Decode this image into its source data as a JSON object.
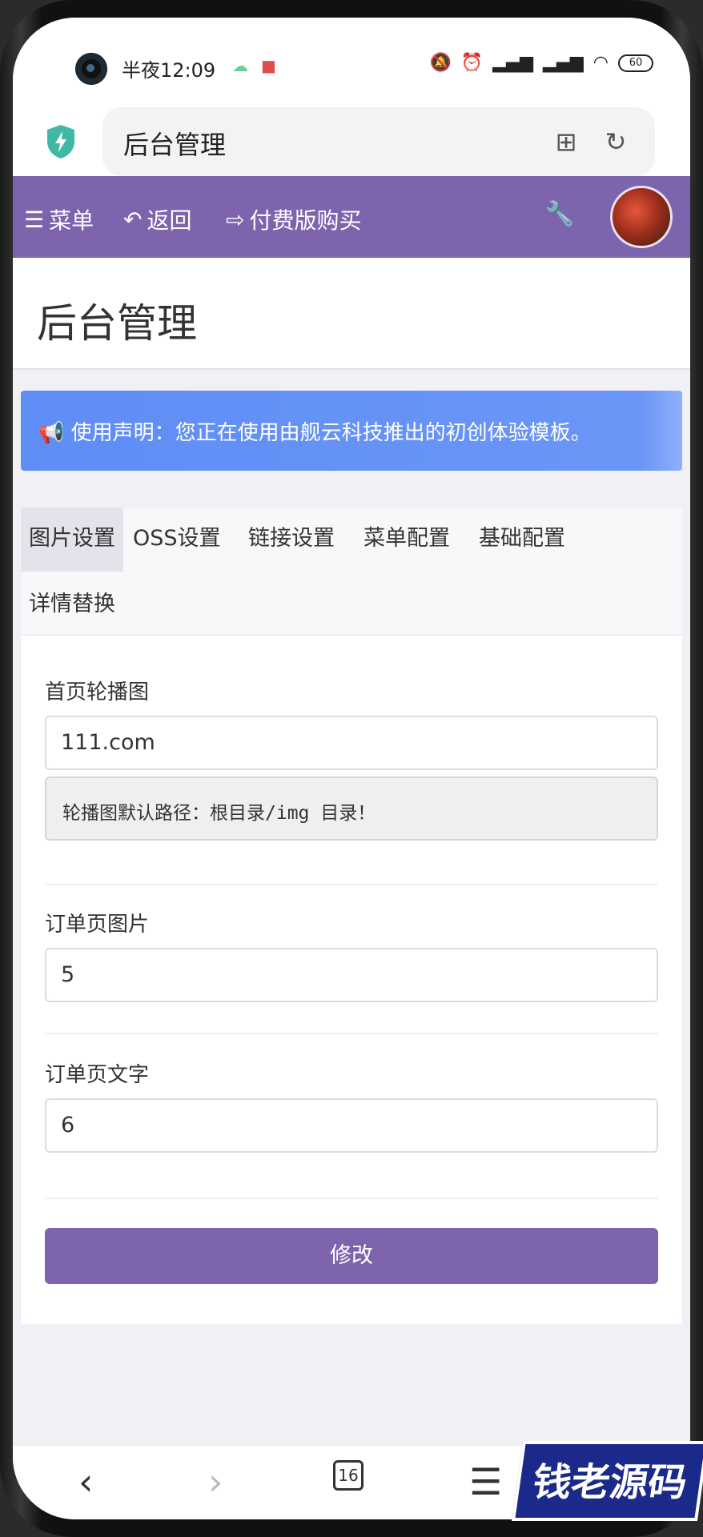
{
  "status_bar": {
    "time": "半夜12:09",
    "battery": "60"
  },
  "browser": {
    "title": "后台管理",
    "tab_count": "16"
  },
  "topnav": {
    "menu": "菜单",
    "back": "返回",
    "buy": "付费版购买"
  },
  "page": {
    "title": "后台管理"
  },
  "alert": {
    "text": "使用声明：您正在使用由舰云科技推出的初创体验模板。"
  },
  "tabs": [
    "图片设置",
    "OSS设置",
    "链接设置",
    "菜单配置",
    "基础配置",
    "详情替换"
  ],
  "form": {
    "carousel_label": "首页轮播图",
    "carousel_value": "111.com",
    "carousel_help": "轮播图默认路径：根目录/img 目录！",
    "order_image_label": "订单页图片",
    "order_image_value": "5",
    "order_text_label": "订单页文字",
    "order_text_value": "6",
    "submit": "修改"
  },
  "watermark": {
    "text": "钱老源码"
  },
  "colors": {
    "nav": "#7d64ad",
    "alert": "#5e8df6",
    "button": "#7d64ad"
  }
}
